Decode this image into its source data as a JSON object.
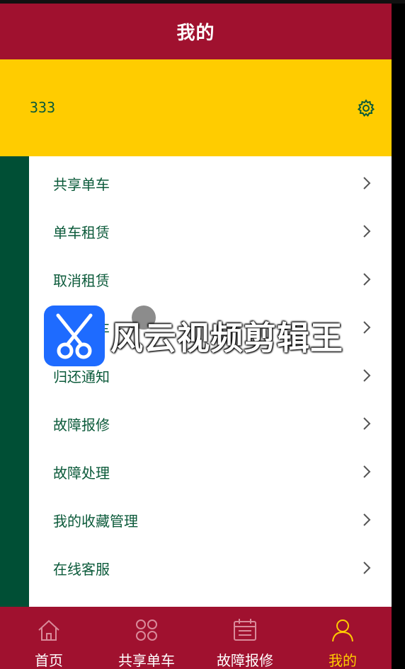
{
  "header": {
    "title": "我的"
  },
  "profile": {
    "username": "333",
    "settings_icon": "gear-icon"
  },
  "menu": {
    "items": [
      {
        "label": "共享单车"
      },
      {
        "label": "单车租赁"
      },
      {
        "label": "取消租赁"
      },
      {
        "label": "归还单车"
      },
      {
        "label": "归还通知"
      },
      {
        "label": "故障报修"
      },
      {
        "label": "故障处理"
      },
      {
        "label": "我的收藏管理"
      },
      {
        "label": "在线客服"
      }
    ]
  },
  "tabbar": {
    "tabs": [
      {
        "label": "首页",
        "icon": "home-icon",
        "active": false
      },
      {
        "label": "共享单车",
        "icon": "grid-icon",
        "active": false
      },
      {
        "label": "故障报修",
        "icon": "calendar-icon",
        "active": false
      },
      {
        "label": "我的",
        "icon": "user-icon",
        "active": true
      }
    ]
  },
  "watermark": {
    "text": "风云视频剪辑王"
  },
  "colors": {
    "header_bg": "#A0112F",
    "profile_bg": "#FFCC00",
    "sidebar_bg": "#004F35",
    "text_green": "#0b5a3a",
    "tab_active": "#FFCC00"
  }
}
